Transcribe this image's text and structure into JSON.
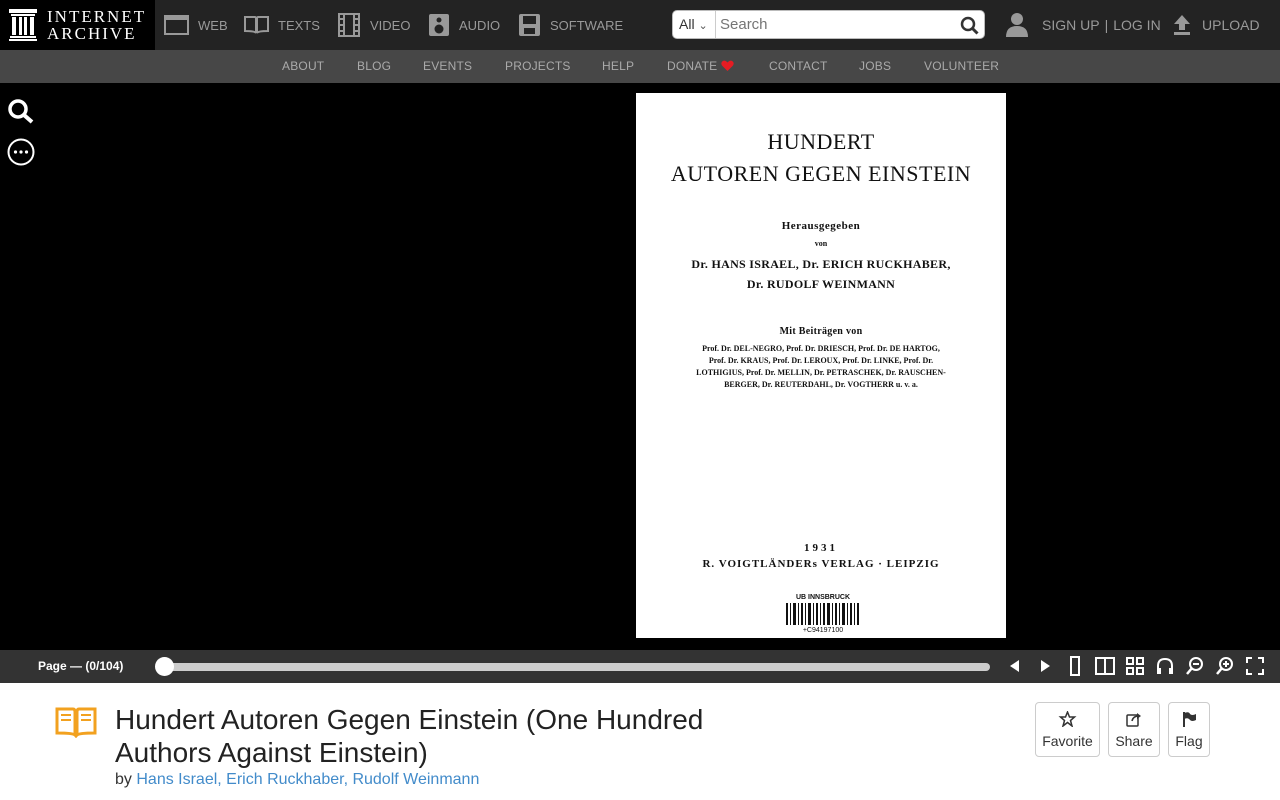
{
  "brand": {
    "line1": "INTERNET",
    "line2": "ARCHIVE"
  },
  "media_nav": [
    {
      "label": "WEB",
      "icon": "web-icon"
    },
    {
      "label": "TEXTS",
      "icon": "texts-icon"
    },
    {
      "label": "VIDEO",
      "icon": "video-icon"
    },
    {
      "label": "AUDIO",
      "icon": "audio-icon"
    },
    {
      "label": "SOFTWARE",
      "icon": "software-icon"
    }
  ],
  "search": {
    "scope": "All",
    "placeholder": "Search"
  },
  "auth": {
    "signup": "SIGN UP",
    "sep": "|",
    "login": "LOG IN"
  },
  "upload": {
    "label": "UPLOAD"
  },
  "sub_nav": [
    "ABOUT",
    "BLOG",
    "EVENTS",
    "PROJECTS",
    "HELP",
    "DONATE",
    "CONTACT",
    "JOBS",
    "VOLUNTEER"
  ],
  "colors": {
    "donate_heart": "#e51c23",
    "link": "#428bca",
    "header_bg": "#232323",
    "subnav_bg": "#474747"
  },
  "book_page": {
    "title_line1": "HUNDERT",
    "title_line2": "AUTOREN GEGEN EINSTEIN",
    "edited": "Herausgegeben",
    "von": "von",
    "editors1": "Dr. HANS ISRAEL, Dr. ERICH RUCKHABER,",
    "editors2": "Dr. RUDOLF WEINMANN",
    "contrib_head": "Mit Beiträgen von",
    "contrib1": "Prof. Dr. DEL-NEGRO, Prof. Dr. DRIESCH, Prof. Dr. DE HARTOG,",
    "contrib2": "Prof. Dr. KRAUS, Prof. Dr. LEROUX, Prof. Dr. LINKE, Prof. Dr.",
    "contrib3": "LOTHIGIUS, Prof. Dr. MELLIN, Dr. PETRASCHEK, Dr. RAUSCHEN-",
    "contrib4": "BERGER, Dr. REUTERDAHL, Dr. VOGTHERR u. v. a.",
    "year": "1931",
    "publisher": "R. VOIGTLÄNDERs VERLAG · LEIPZIG",
    "stamp": "UB INNSBRUCK",
    "stamp_no": "+C94197100"
  },
  "reader_nav": {
    "page_label": "Page — (0/104)",
    "progress": 0.0
  },
  "item": {
    "title": "Hundert Autoren Gegen Einstein (One Hundred Authors Against Einstein)",
    "by": "by",
    "authors": "Hans Israel, Erich Ruckhaber, Rudolf Weinmann"
  },
  "actions": {
    "favorite": "Favorite",
    "share": "Share",
    "flag": "Flag"
  }
}
